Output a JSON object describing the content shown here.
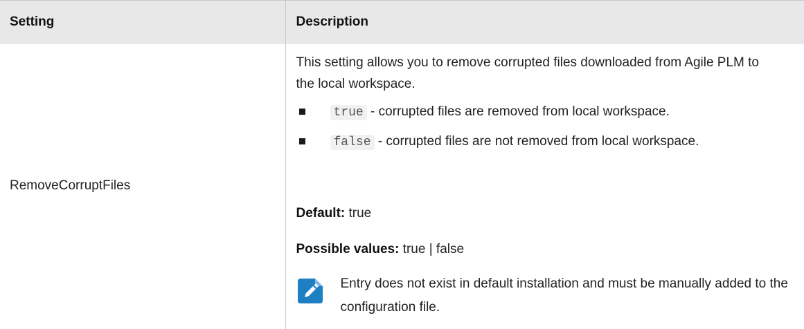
{
  "table": {
    "headers": {
      "setting": "Setting",
      "description": "Description"
    },
    "row": {
      "setting": "RemoveCorruptFiles",
      "intro": "This setting allows you to remove corrupted files downloaded from Agile PLM to the local workspace.",
      "bullets": [
        {
          "code": "true",
          "text": " - corrupted files are removed from local workspace."
        },
        {
          "code": "false",
          "text": " - corrupted files are not removed from local workspace."
        }
      ],
      "default_label": "Default:",
      "default_value": " true",
      "possible_label": "Possible values:",
      "possible_value": " true | false",
      "note_icon": "pencil-note-icon",
      "note_text": "Entry does not exist in default installation and must be manually added to the configuration file."
    }
  },
  "colors": {
    "header_bg": "#e8e8e8",
    "border": "#c8c8c8",
    "note_icon": "#1e7fc3"
  }
}
